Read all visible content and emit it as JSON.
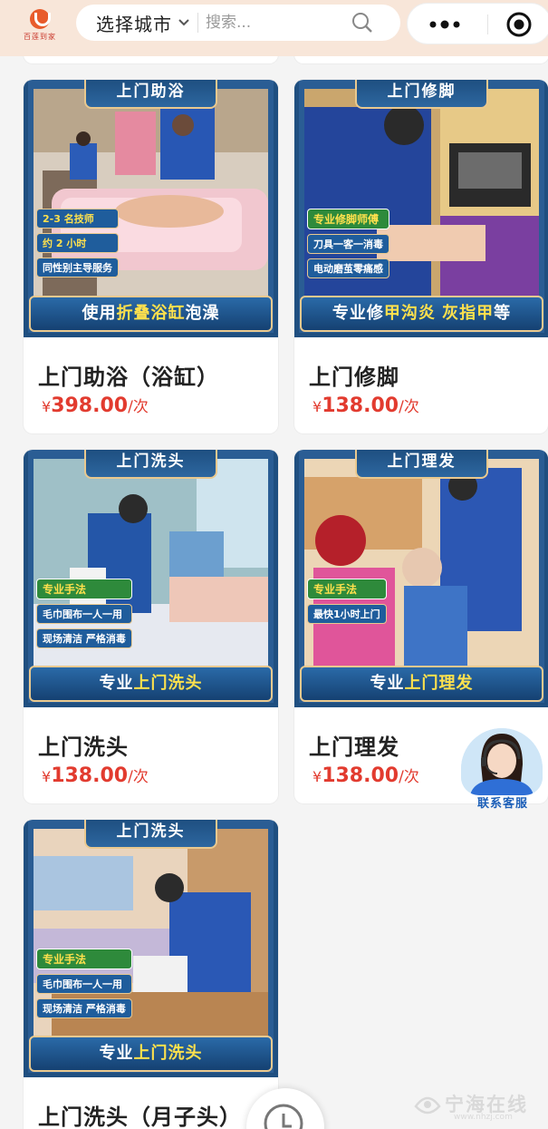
{
  "header": {
    "logo_text": "百莲到家",
    "city_label": "选择城市",
    "search_placeholder": "搜索..."
  },
  "cards": [
    {
      "tag": "上门助浴",
      "banner_prefix": "使用",
      "banner_highlight": "折叠浴缸",
      "banner_suffix": "泡澡",
      "chips": [
        "2-3 名技师",
        "约 2 小时",
        "同性别主导服务"
      ],
      "title": "上门助浴（浴缸）",
      "price_symbol": "¥",
      "price": "398.00",
      "price_unit": "/次"
    },
    {
      "tag": "上门修脚",
      "banner_prefix": "专业修",
      "banner_highlight": "甲沟炎 灰指甲",
      "banner_suffix": "等",
      "chips": [
        "专业修脚师傅",
        "刀具一客一消毒",
        "电动磨茧零痛感"
      ],
      "title": "上门修脚",
      "price_symbol": "¥",
      "price": "138.00",
      "price_unit": "/次"
    },
    {
      "tag": "上门洗头",
      "banner_prefix": "专业",
      "banner_highlight": "上门洗头",
      "banner_suffix": "",
      "chips": [
        "专业手法",
        "毛巾围布一人一用",
        "现场清洁 严格消毒"
      ],
      "title": "上门洗头",
      "price_symbol": "¥",
      "price": "138.00",
      "price_unit": "/次"
    },
    {
      "tag": "上门理发",
      "banner_prefix": "专业",
      "banner_highlight": "上门理发",
      "banner_suffix": "",
      "chips": [
        "专业手法",
        "最快1小时上门"
      ],
      "title": "上门理发",
      "price_symbol": "¥",
      "price": "138.00",
      "price_unit": "/次"
    },
    {
      "tag": "上门洗头",
      "banner_prefix": "专业",
      "banner_highlight": "上门洗头",
      "banner_suffix": "",
      "chips": [
        "专业手法",
        "毛巾围布一人一用",
        "现场清洁 严格消毒"
      ],
      "title": "上门洗头（月子头）",
      "price_symbol": "",
      "price": "",
      "price_unit": ""
    }
  ],
  "service": {
    "label": "联系客服"
  },
  "watermark": {
    "text": "宁海在线",
    "sub": "www.nhzj.com"
  },
  "colors": {
    "header_bg": "#f8e6d9",
    "card_frame": "#1f4f80",
    "price": "#e23b2f",
    "highlight": "#ffe14d"
  },
  "icons": {
    "search": "search-icon",
    "more": "more-icon",
    "target": "target-icon",
    "chevron": "chevron-down-icon",
    "back": "back-to-top-icon"
  }
}
